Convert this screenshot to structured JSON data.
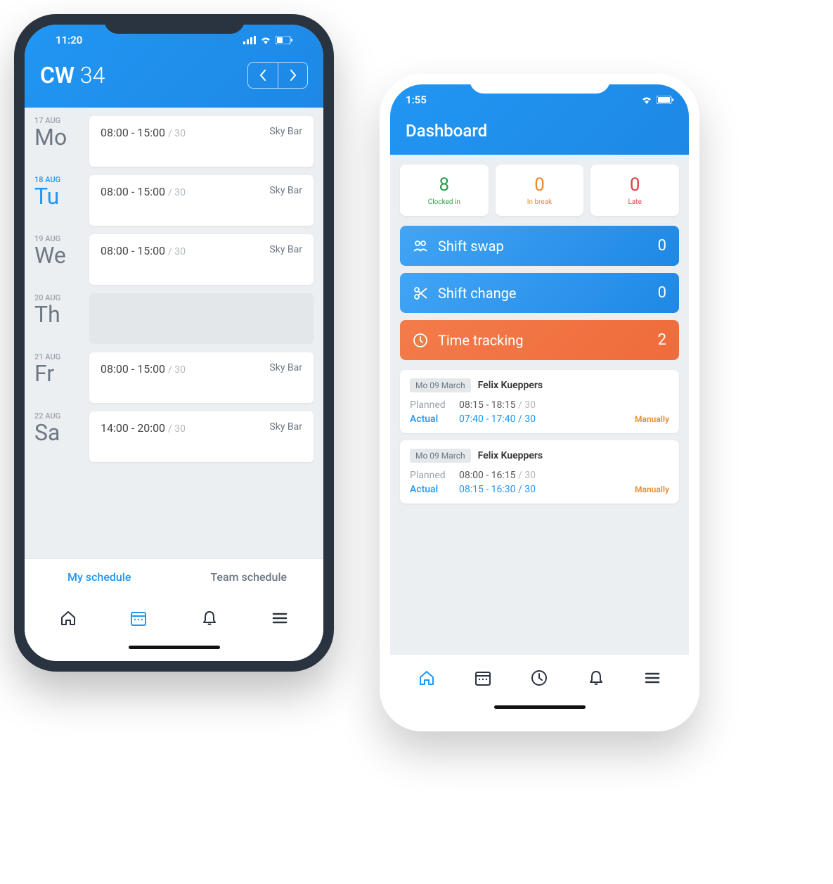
{
  "phoneA": {
    "status_time": "11:20",
    "header_prefix": "CW",
    "header_week": "34",
    "days": [
      {
        "date": "17 AUG",
        "abbr": "Mo",
        "time": "08:00 - 15:00",
        "dur": "/ 30",
        "loc": "Sky Bar",
        "empty": false,
        "active": false
      },
      {
        "date": "18 AUG",
        "abbr": "Tu",
        "time": "08:00 - 15:00",
        "dur": "/ 30",
        "loc": "Sky Bar",
        "empty": false,
        "active": true
      },
      {
        "date": "19 AUG",
        "abbr": "We",
        "time": "08:00 - 15:00",
        "dur": "/ 30",
        "loc": "Sky Bar",
        "empty": false,
        "active": false
      },
      {
        "date": "20 AUG",
        "abbr": "Th",
        "time": "",
        "dur": "",
        "loc": "",
        "empty": true,
        "active": false
      },
      {
        "date": "21 AUG",
        "abbr": "Fr",
        "time": "08:00 - 15:00",
        "dur": "/ 30",
        "loc": "Sky Bar",
        "empty": false,
        "active": false
      },
      {
        "date": "22 AUG",
        "abbr": "Sa",
        "time": "14:00 - 20:00",
        "dur": "/ 30",
        "loc": "Sky Bar",
        "empty": false,
        "active": false
      }
    ],
    "tabs": {
      "my": "My schedule",
      "team": "Team schedule"
    }
  },
  "phoneB": {
    "status_time": "1:55",
    "title": "Dashboard",
    "metrics": [
      {
        "num": "8",
        "label": "Clocked in",
        "color": "green"
      },
      {
        "num": "0",
        "label": "In break",
        "color": "orange"
      },
      {
        "num": "0",
        "label": "Late",
        "color": "red"
      }
    ],
    "actions": [
      {
        "label": "Shift swap",
        "count": "0",
        "color": "blue",
        "icon": "people"
      },
      {
        "label": "Shift change",
        "count": "0",
        "color": "blue",
        "icon": "scissors"
      },
      {
        "label": "Time tracking",
        "count": "2",
        "color": "orange",
        "icon": "clock"
      }
    ],
    "entries": [
      {
        "badge": "Mo 09 March",
        "name": "Felix Kueppers",
        "planned_lbl": "Planned",
        "planned": "08:15 - 18:15",
        "planned_dur": "/ 30",
        "actual_lbl": "Actual",
        "actual": "07:40 - 17:40",
        "actual_dur": "/ 30",
        "manual": "Manually"
      },
      {
        "badge": "Mo 09 March",
        "name": "Felix Kueppers",
        "planned_lbl": "Planned",
        "planned": "08:00 - 16:15",
        "planned_dur": "/ 30",
        "actual_lbl": "Actual",
        "actual": "08:15 - 16:30",
        "actual_dur": "/ 30",
        "manual": "Manually"
      }
    ]
  }
}
